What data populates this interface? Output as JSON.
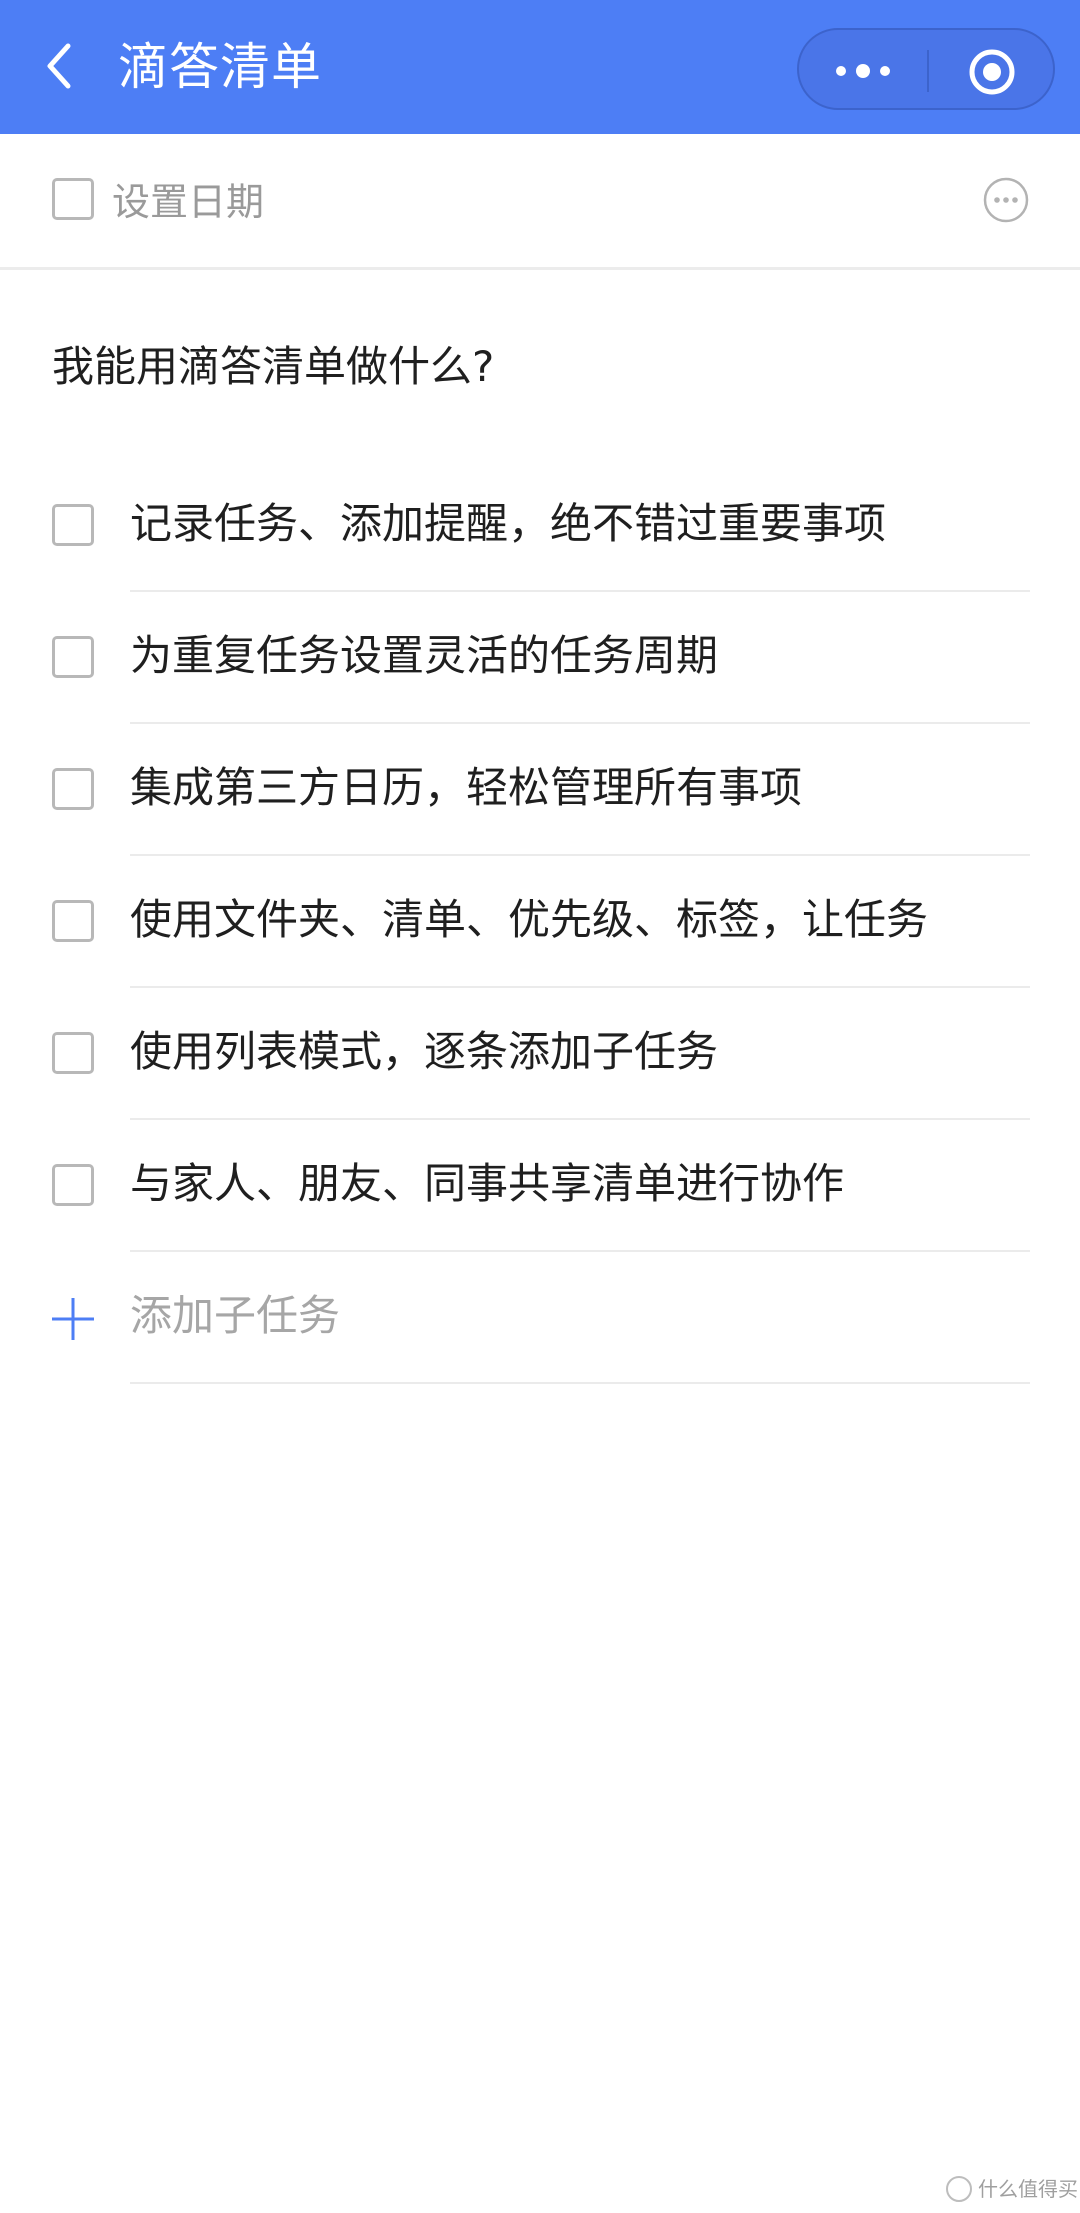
{
  "nav": {
    "title": "滴答清单",
    "back_icon": "chevron-left-icon",
    "more_icon": "more-horizontal-icon",
    "close_icon": "target-icon",
    "background_color": "#4d7ef5"
  },
  "date_bar": {
    "label": "设置日期",
    "more_icon": "more-circle-icon"
  },
  "task": {
    "title": "我能用滴答清单做什么?",
    "subtasks": [
      {
        "label": "记录任务、添加提醒，绝不错过重要事项",
        "checked": false
      },
      {
        "label": "为重复任务设置灵活的任务周期",
        "checked": false
      },
      {
        "label": "集成第三方日历，轻松管理所有事项",
        "checked": false
      },
      {
        "label": "使用文件夹、清单、优先级、标签，让任务",
        "checked": false
      },
      {
        "label": "使用列表模式，逐条添加子任务",
        "checked": false
      },
      {
        "label": "与家人、朋友、同事共享清单进行协作",
        "checked": false
      }
    ],
    "add_subtask_label": "添加子任务"
  },
  "watermark": "什么值得买",
  "colors": {
    "accent": "#4d7ef5",
    "text": "#1f1f1f",
    "muted": "#9a9a9a"
  }
}
